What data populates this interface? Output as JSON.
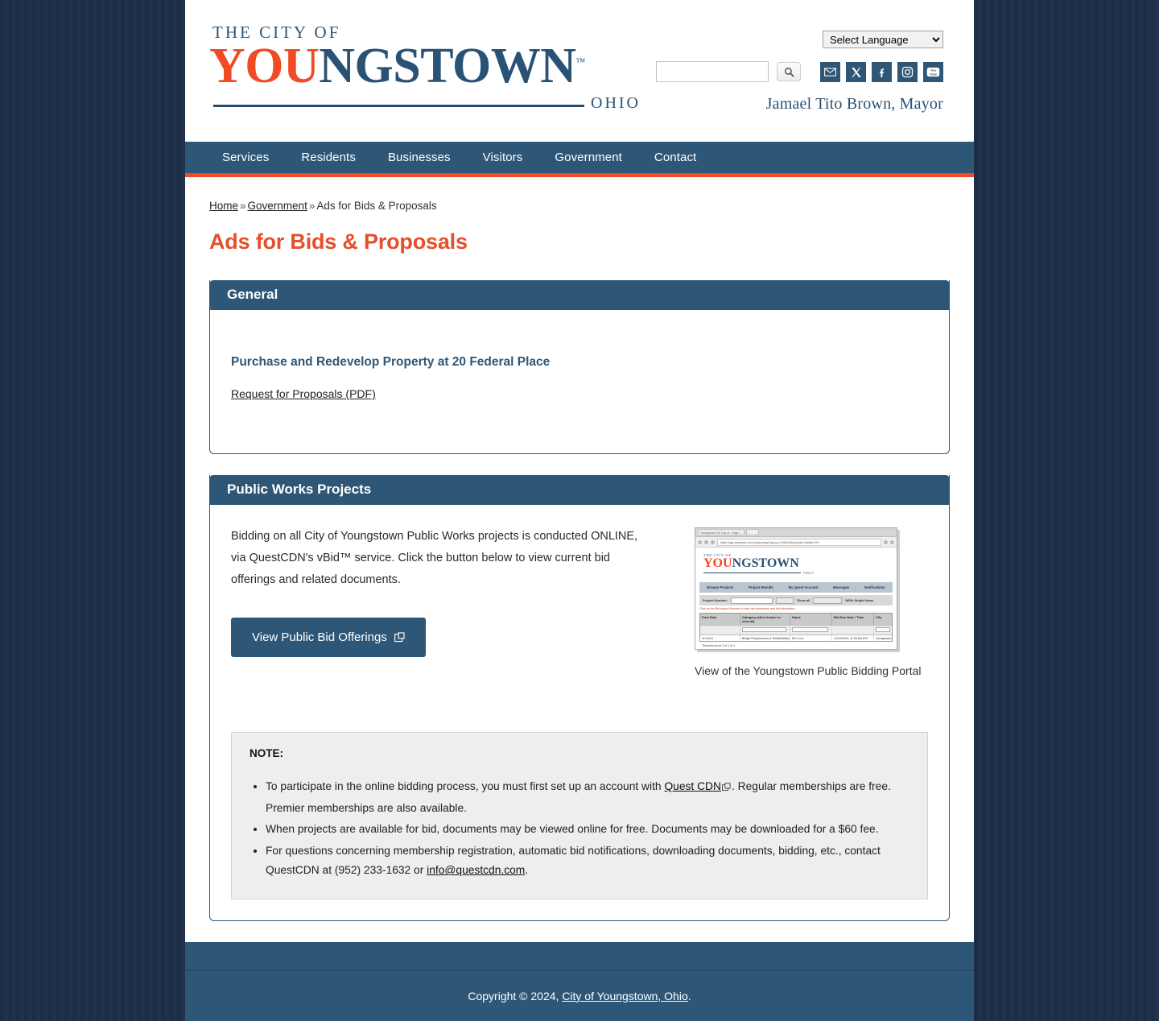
{
  "header": {
    "logo": {
      "line1": "THE CITY OF",
      "you": "YOU",
      "ngstown": "NGSTOWN",
      "state": "OHIO"
    },
    "language_selected": "Select Language",
    "search_placeholder": "",
    "search_value": "",
    "mayor": "Jamael Tito Brown, Mayor",
    "social": [
      {
        "name": "email-icon",
        "label": "Email"
      },
      {
        "name": "x-twitter-icon",
        "label": "X"
      },
      {
        "name": "facebook-icon",
        "label": "Facebook"
      },
      {
        "name": "instagram-icon",
        "label": "Instagram"
      },
      {
        "name": "youtube-icon",
        "label": "YouTube"
      }
    ]
  },
  "nav": {
    "items": [
      {
        "label": "Services"
      },
      {
        "label": "Residents"
      },
      {
        "label": "Businesses"
      },
      {
        "label": "Visitors"
      },
      {
        "label": "Government"
      },
      {
        "label": "Contact"
      }
    ]
  },
  "breadcrumb": {
    "home": "Home",
    "sep1": "»",
    "government": "Government",
    "sep2": "»",
    "current": "Ads for Bids & Proposals"
  },
  "page_title": "Ads for Bids & Proposals",
  "general_card": {
    "header": "General",
    "item_title": "Purchase and Redevelop Property at 20 Federal Place",
    "item_link": "Request for Proposals (PDF)"
  },
  "public_works_card": {
    "header": "Public Works Projects",
    "paragraph": "Bidding on all City of Youngstown Public Works projects is conducted ONLINE, via QuestCDN's vBid™ service. Click the button below to view current bid offerings and related documents.",
    "button_label": "View Public Bid Offerings",
    "image_caption": "View of the Youngstown Public Bidding Portal",
    "thumbnail": {
      "tab_title": "Youngstown OH City of - Page 1",
      "url": "https://app.questcdn.com/cdn/posting/?group=1130415&provider=&state=OH",
      "logo_line1": "THE CITY OF",
      "logo_you": "YOU",
      "logo_ngstown": "NGSTOWN",
      "logo_state": "OHIO",
      "nav": [
        "Browse Projects",
        "Project Results",
        "My Quest Account",
        "Messages",
        "Notifications"
      ],
      "filter_label": "Project Number:",
      "filter_btn": "Search",
      "filter_show": "Show all",
      "filter_select": "--- Per Page ---",
      "filter_right": "NEW: Bright News",
      "red_note": "Click on the Bid project Number to view bid documents and bid information.",
      "columns": [
        "Post Date",
        "Category (click header to view all)",
        "Name",
        "Bid Due Date / Time",
        "City"
      ],
      "row": {
        "post_date": "11/15/24",
        "category": "Bridge Replacement or Rehabilitation",
        "name": "Bid Docs",
        "bid_due": "12/10/2024, 11:00 AM EST",
        "city": "Youngstown"
      },
      "footer": "Records found 1 of 1 of 1"
    }
  },
  "note": {
    "title": "NOTE:",
    "items": [
      {
        "pre": "To participate in the online bidding process, you must first set up an account with ",
        "link": "Quest CDN",
        "post": ". Regular memberships are free. Premier memberships are also available."
      },
      {
        "pre": "When projects are available for bid, documents may be viewed online for free. Documents may be downloaded for a $60 fee.",
        "link": "",
        "post": ""
      },
      {
        "pre": "For questions concerning membership registration, automatic bid notifications, downloading documents, bidding, etc., contact QuestCDN at (952) 233-1632 or ",
        "link": "info@questcdn.com",
        "post": "."
      }
    ]
  },
  "footer": {
    "copyright_pre": "Copyright © 2024, ",
    "copyright_link": "City of Youngstown, Ohio",
    "copyright_post": "."
  },
  "colors": {
    "brand_blue": "#2e5777",
    "brand_orange": "#ef4b24",
    "title_orange": "#e4502a",
    "page_bg": "#1d2d44"
  }
}
